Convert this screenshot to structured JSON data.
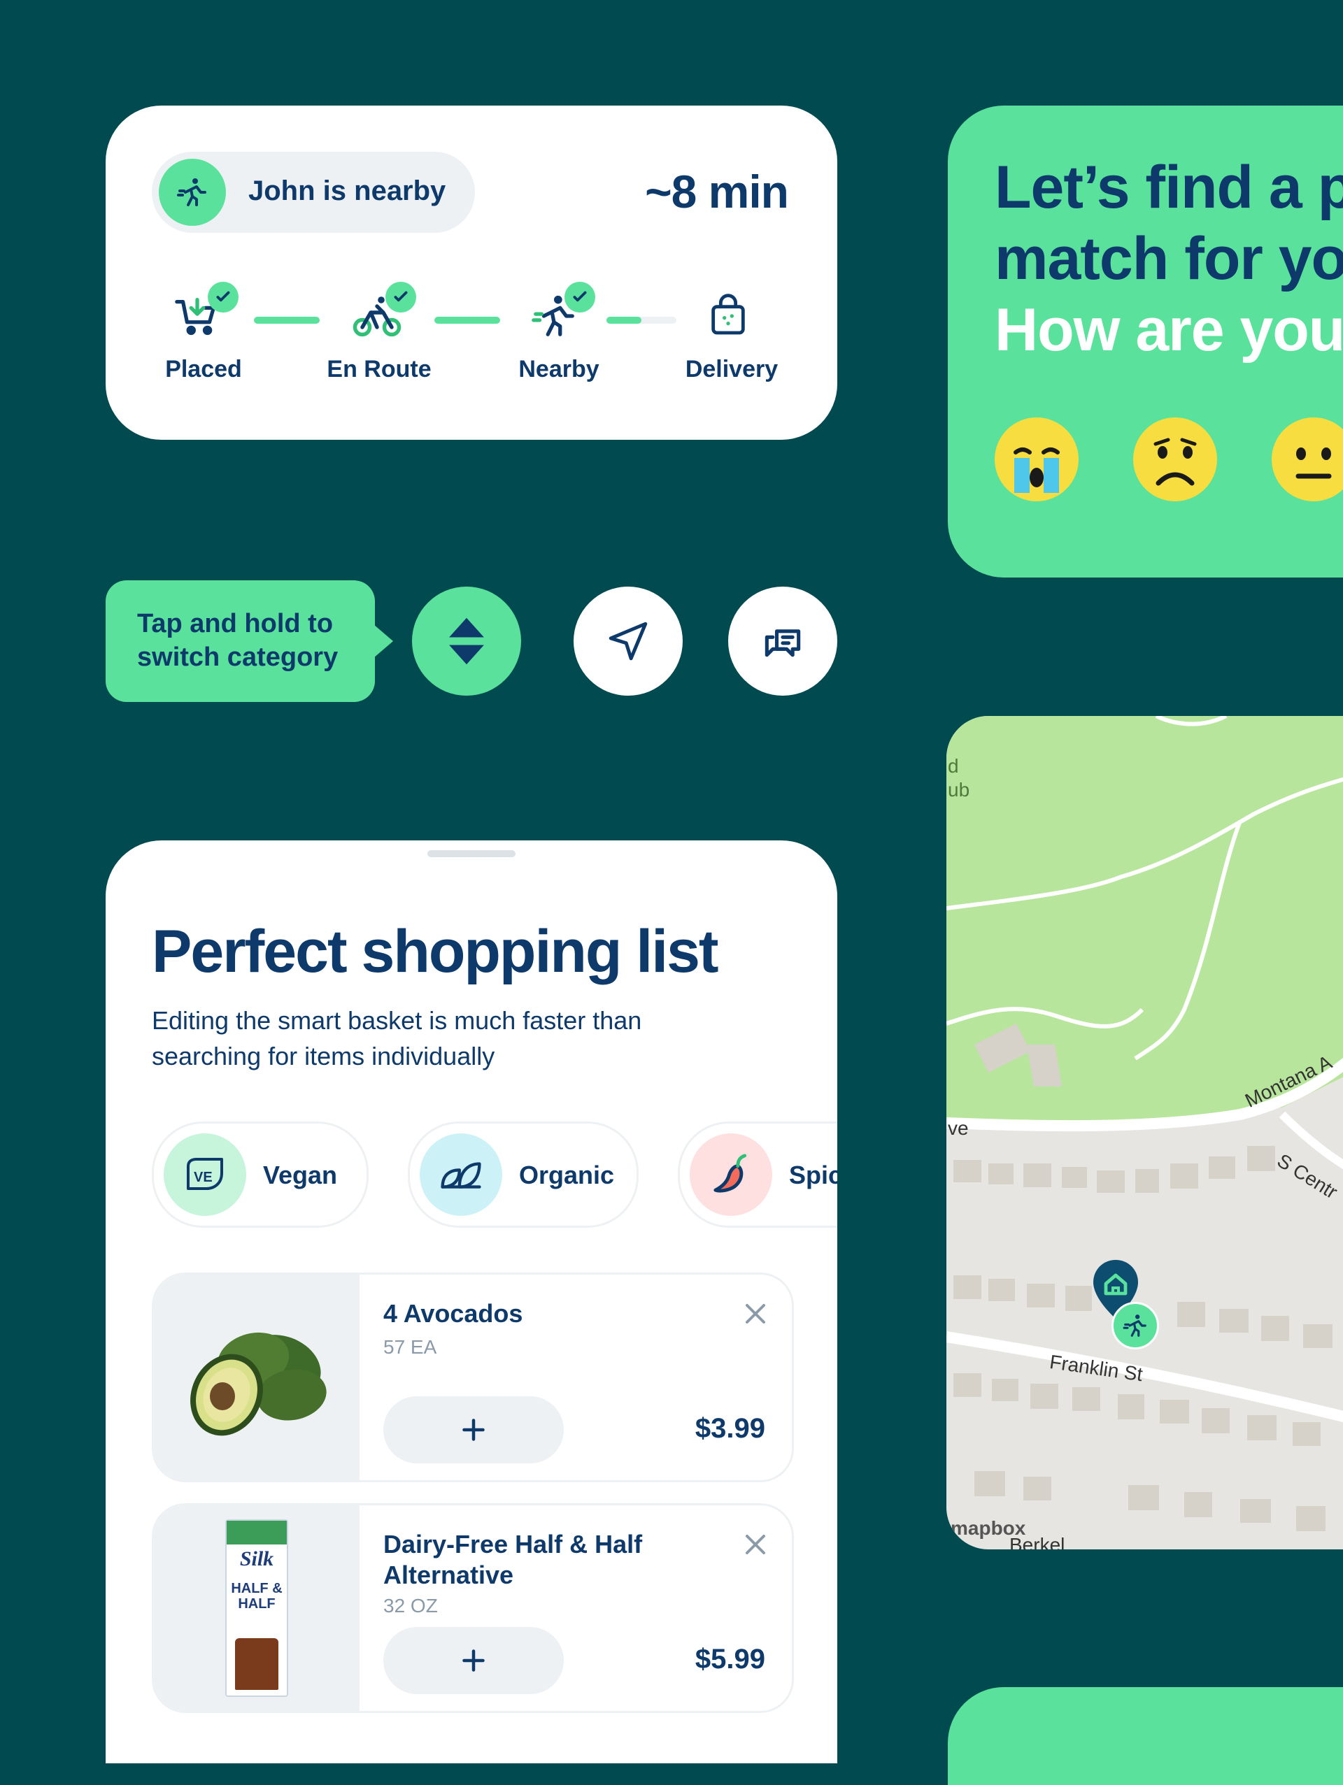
{
  "colors": {
    "background": "#014a50",
    "accent_green": "#5ae29d",
    "navy_text": "#0e3a6b",
    "card": "#ffffff",
    "muted": "#eef1f3"
  },
  "tracker": {
    "courier_status": "John is nearby",
    "eta": "~8 min",
    "steps": [
      {
        "label": "Placed",
        "icon": "cart-icon",
        "done": true
      },
      {
        "label": "En Route",
        "icon": "bicycle-icon",
        "done": true
      },
      {
        "label": "Nearby",
        "icon": "runner-icon",
        "done": true
      },
      {
        "label": "Delivery",
        "icon": "bag-icon",
        "done": false
      }
    ],
    "progress_last_segment": 0.5
  },
  "hint": {
    "text": "Tap and hold to switch category"
  },
  "actions": [
    {
      "name": "switch-category-button",
      "icon": "up-down-icon"
    },
    {
      "name": "navigate-button",
      "icon": "navigation-arrow-icon"
    },
    {
      "name": "chat-button",
      "icon": "chat-icon"
    }
  ],
  "shopping_list": {
    "title": "Perfect shopping list",
    "subtitle": "Editing the smart basket is much faster than searching for items individually",
    "chips": [
      {
        "label": "Vegan",
        "icon": "vegan-leaf-icon"
      },
      {
        "label": "Organic",
        "icon": "leaves-icon"
      },
      {
        "label": "Spic",
        "icon": "chili-pepper-icon"
      }
    ],
    "items": [
      {
        "name": "4 Avocados",
        "qty": "57 EA",
        "price": "$3.99",
        "image": "avocado-image"
      },
      {
        "name": "Dairy-Free Half & Half Alternative",
        "qty": "32 OZ",
        "price": "$5.99",
        "image": "silk-carton-image"
      }
    ],
    "carton_brand": "Silk",
    "carton_text": "HALF & HALF"
  },
  "mood": {
    "lines": [
      "Let’s find a p",
      "match for yo",
      "How are you"
    ],
    "emojis": [
      "crying-face-icon",
      "sad-face-icon",
      "neutral-face-icon"
    ]
  },
  "map": {
    "labels": {
      "top_left_1": "d",
      "top_left_2": "ub",
      "left_street": "ve",
      "montana": "Montana A",
      "s_central": "S Centr",
      "franklin": "Franklin St",
      "attribution": "mapbox",
      "berkeley": "Berkel"
    }
  }
}
